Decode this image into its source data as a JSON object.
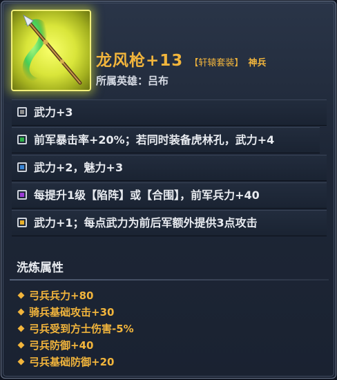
{
  "item": {
    "name": "龙风枪+13",
    "set_tag": "【轩辕套装】",
    "rarity": "神兵",
    "icon": "spear-icon",
    "hero_label": "所属英雄：",
    "hero_name": "吕布"
  },
  "attributes": [
    {
      "color": "#8c8c8c",
      "text": "武力+3"
    },
    {
      "color": "#2fb24a",
      "text": "前军暴击率+20%；若同时装备虎林孔，武力+4"
    },
    {
      "color": "#3a86d6",
      "text": "武力+2，魅力+3"
    },
    {
      "color": "#9b3ad6",
      "text": "每提升1级【陷阵】或【合围】，前军兵力+40"
    },
    {
      "color": "#e8b02a",
      "text": "武力+1；每点武力为前后军额外提供3点攻击"
    }
  ],
  "wash": {
    "title": "洗炼属性",
    "items": [
      "弓兵兵力+80",
      "骑兵基础攻击+30",
      "弓兵受到方士伤害-5%",
      "弓兵防御+40",
      "弓兵基础防御+20"
    ]
  }
}
